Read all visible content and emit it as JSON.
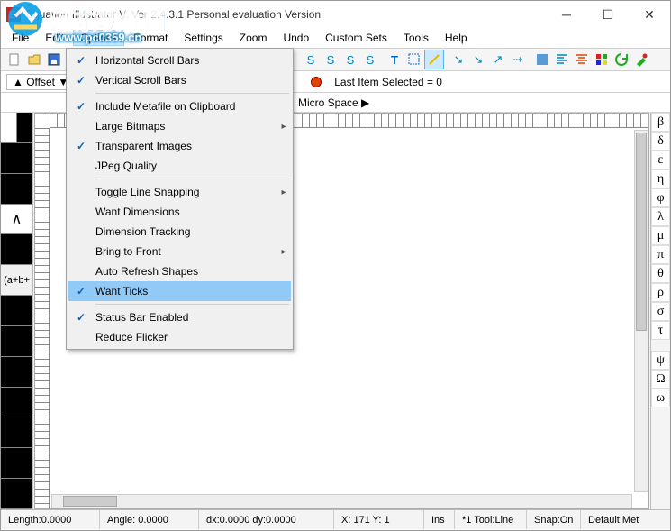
{
  "window": {
    "title": "Equation Illustrator V.  Ver 2.4.3.1 Personal evaluation Version"
  },
  "watermark": {
    "text": "河东软件园",
    "url": "www.pc0359.cn"
  },
  "menu": {
    "file": "File",
    "edit": "Edit",
    "options": "Options",
    "format": "Format",
    "settings": "Settings",
    "zoom": "Zoom",
    "undo": "Undo",
    "custom_sets": "Custom Sets",
    "tools": "Tools",
    "help": "Help"
  },
  "options_menu": {
    "horizontal_scroll_bars": "Horizontal Scroll Bars",
    "vertical_scroll_bars": "Vertical Scroll Bars",
    "include_metafile": "Include Metafile on Clipboard",
    "large_bitmaps": "Large Bitmaps",
    "transparent_images": "Transparent Images",
    "jpeg_quality": "JPeg Quality",
    "toggle_line_snapping": "Toggle Line Snapping",
    "want_dimensions": "Want Dimensions",
    "dimension_tracking": "Dimension Tracking",
    "bring_to_front": "Bring to Front",
    "auto_refresh_shapes": "Auto Refresh Shapes",
    "want_ticks": "Want Ticks",
    "status_bar_enabled": "Status Bar Enabled",
    "reduce_flicker": "Reduce Flicker"
  },
  "secondbar": {
    "offset": "▲ Offset ▼",
    "last_item": "Last Item Selected = 0"
  },
  "thirdbar": {
    "micro_space": "Micro Space  ▶"
  },
  "leftpal": {
    "wedge": "∧",
    "expr": "(a+b+"
  },
  "rightpal": {
    "symbols": [
      "β",
      "δ",
      "ε",
      "η",
      "φ",
      "λ",
      "μ",
      "π",
      "θ",
      "ρ",
      "σ",
      "τ",
      "ψ",
      "Ω",
      "ω"
    ]
  },
  "status": {
    "length": "Length:0.0000",
    "angle": "Angle:  0.0000",
    "dxdy": "dx:0.0000  dy:0.0000",
    "xy": "X: 171 Y: 1",
    "ins": "Ins",
    "tool": "*1 Tool:Line",
    "snap": "Snap:On",
    "default": "Default:Met"
  }
}
